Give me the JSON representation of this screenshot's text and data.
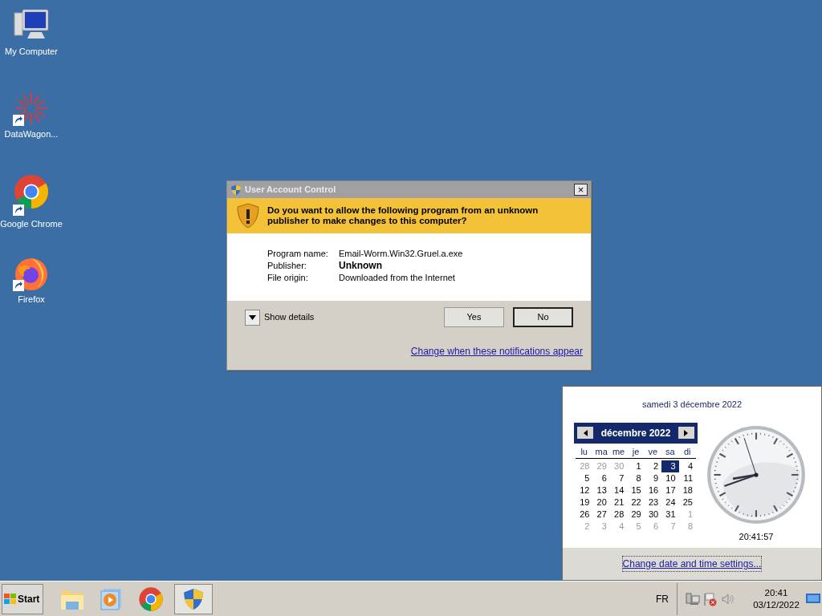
{
  "desktop_icons": [
    {
      "label": "My Computer",
      "kind": "computer",
      "shortcut": false
    },
    {
      "label": "DataWagon...",
      "kind": "burst",
      "shortcut": true
    },
    {
      "label": "Google Chrome",
      "kind": "chrome",
      "shortcut": true
    },
    {
      "label": "Firefox",
      "kind": "firefox",
      "shortcut": true
    }
  ],
  "dialog": {
    "title": "User Account Control",
    "question": "Do you want to allow the following program from an unknown publisher to make changes to this computer?",
    "details": [
      {
        "label": "Program name:",
        "value": "Email-Worm.Win32.Gruel.a.exe",
        "bold": false
      },
      {
        "label": "Publisher:",
        "value": "Unknown",
        "bold": true
      },
      {
        "label": "File origin:",
        "value": "Downloaded from the Internet",
        "bold": false
      }
    ],
    "show_details": "Show details",
    "expanded": false,
    "buttons": [
      {
        "label": "Yes",
        "default": false
      },
      {
        "label": "No",
        "default": true
      }
    ],
    "link": "Change when these notifications appear",
    "close": "×"
  },
  "calendar_popup": {
    "date_heading": "samedi 3 décembre 2022",
    "month": "décembre 2022",
    "weekdays": [
      "lu",
      "ma",
      "me",
      "je",
      "ve",
      "sa",
      "di"
    ],
    "weeks": [
      [
        {
          "day": "28",
          "outside": true,
          "selected": false
        },
        {
          "day": "29",
          "outside": true,
          "selected": false
        },
        {
          "day": "30",
          "outside": true,
          "selected": false
        },
        {
          "day": "1",
          "outside": false,
          "selected": false
        },
        {
          "day": "2",
          "outside": false,
          "selected": false
        },
        {
          "day": "3",
          "outside": false,
          "selected": true
        },
        {
          "day": "4",
          "outside": false,
          "selected": false
        }
      ],
      [
        {
          "day": "5",
          "outside": false,
          "selected": false
        },
        {
          "day": "6",
          "outside": false,
          "selected": false
        },
        {
          "day": "7",
          "outside": false,
          "selected": false
        },
        {
          "day": "8",
          "outside": false,
          "selected": false
        },
        {
          "day": "9",
          "outside": false,
          "selected": false
        },
        {
          "day": "10",
          "outside": false,
          "selected": false
        },
        {
          "day": "11",
          "outside": false,
          "selected": false
        }
      ],
      [
        {
          "day": "12",
          "outside": false,
          "selected": false
        },
        {
          "day": "13",
          "outside": false,
          "selected": false
        },
        {
          "day": "14",
          "outside": false,
          "selected": false
        },
        {
          "day": "15",
          "outside": false,
          "selected": false
        },
        {
          "day": "16",
          "outside": false,
          "selected": false
        },
        {
          "day": "17",
          "outside": false,
          "selected": false
        },
        {
          "day": "18",
          "outside": false,
          "selected": false
        }
      ],
      [
        {
          "day": "19",
          "outside": false,
          "selected": false
        },
        {
          "day": "20",
          "outside": false,
          "selected": false
        },
        {
          "day": "21",
          "outside": false,
          "selected": false
        },
        {
          "day": "22",
          "outside": false,
          "selected": false
        },
        {
          "day": "23",
          "outside": false,
          "selected": false
        },
        {
          "day": "24",
          "outside": false,
          "selected": false
        },
        {
          "day": "25",
          "outside": false,
          "selected": false
        }
      ],
      [
        {
          "day": "26",
          "outside": false,
          "selected": false
        },
        {
          "day": "27",
          "outside": false,
          "selected": false
        },
        {
          "day": "28",
          "outside": false,
          "selected": false
        },
        {
          "day": "29",
          "outside": false,
          "selected": false
        },
        {
          "day": "30",
          "outside": false,
          "selected": false
        },
        {
          "day": "31",
          "outside": false,
          "selected": false
        },
        {
          "day": "1",
          "outside": true,
          "selected": false
        }
      ],
      [
        {
          "day": "2",
          "outside": true,
          "selected": false
        },
        {
          "day": "3",
          "outside": true,
          "selected": false
        },
        {
          "day": "4",
          "outside": true,
          "selected": false
        },
        {
          "day": "5",
          "outside": true,
          "selected": false
        },
        {
          "day": "6",
          "outside": true,
          "selected": false
        },
        {
          "day": "7",
          "outside": true,
          "selected": false
        },
        {
          "day": "8",
          "outside": true,
          "selected": false
        }
      ]
    ],
    "time": "20:41:57",
    "link": "Change date and time settings..."
  },
  "taskbar": {
    "start": "Start",
    "pinned": [
      {
        "kind": "folder",
        "selected": false
      },
      {
        "kind": "media",
        "selected": false
      },
      {
        "kind": "chrome",
        "selected": false
      },
      {
        "kind": "shield",
        "selected": true
      }
    ],
    "language": "FR",
    "tray_icons": [
      {
        "kind": "network"
      },
      {
        "kind": "flag"
      },
      {
        "kind": "speaker"
      }
    ],
    "time": "20:41",
    "date": "03/12/2022"
  }
}
